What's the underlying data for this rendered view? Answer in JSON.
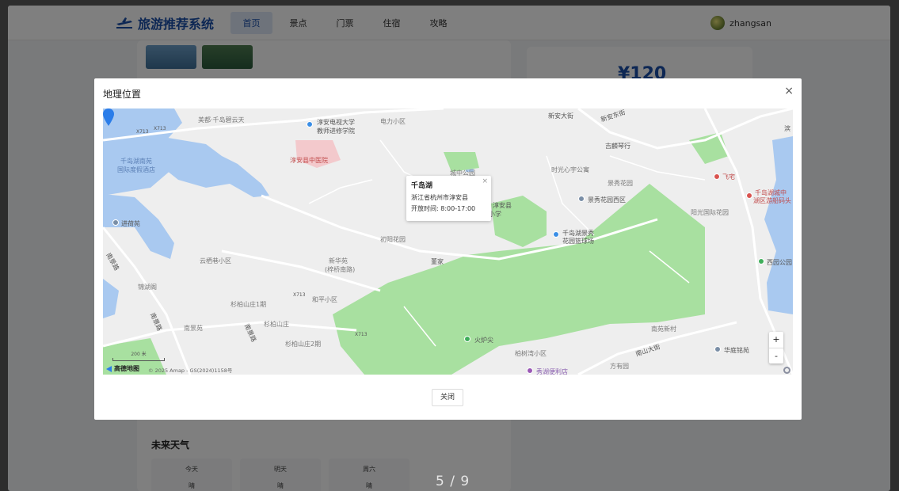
{
  "app": {
    "brand": "旅游推荐系统",
    "nav": [
      {
        "label": "首页",
        "active": true
      },
      {
        "label": "景点",
        "active": false
      },
      {
        "label": "门票",
        "active": false
      },
      {
        "label": "住宿",
        "active": false
      },
      {
        "label": "攻略",
        "active": false
      }
    ],
    "username": "zhangsan"
  },
  "background": {
    "price": "¥120",
    "weather_title": "未来天气",
    "weather": [
      {
        "day": "今天",
        "cond": "晴"
      },
      {
        "day": "明天",
        "cond": "晴"
      },
      {
        "day": "周六",
        "cond": "晴"
      }
    ],
    "page_indicator": "5 / 9"
  },
  "modal": {
    "title": "地理位置",
    "close_icon": "×",
    "close_button": "关闭",
    "map": {
      "info": {
        "name": "千岛湖",
        "address": "浙江省杭州市淳安县",
        "hours": "开放时间: 8:00-17:00",
        "close_icon": "×"
      },
      "labels": [
        "美都·千岛碧云天",
        "淳安电视大学",
        "教师进修学院",
        "电力小区",
        "新安大街",
        "新安东街",
        "吉麟琴行",
        "千岛湖南苑",
        "国际度假酒店",
        "淳安县中医院",
        "城中公园",
        "时光心宇公寓",
        "景秀花园",
        "飞宅",
        "千岛湖城中",
        "湖区游船码头",
        "淳安县",
        "小学",
        "景秀花园西区",
        "进荷苑",
        "初阳花园",
        "千岛湖景秀",
        "花园篮球场",
        "阳光国际花园",
        "西园公园",
        "云栖巷小区",
        "新华苑",
        "(梓桥南路)",
        "董家",
        "锦湖阁",
        "和平小区",
        "杉柏山庄1期",
        "杉柏山庄",
        "南景苑",
        "杉柏山庄2期",
        "南苑新村",
        "火炉尖",
        "南山大街",
        "华庭铭苑",
        "柏树湾小区",
        "方有园",
        "秀湖便利店",
        "南景路",
        "南景路",
        "南景路",
        "X713",
        "X713",
        "X713",
        "X713",
        "滨"
      ],
      "zoom_in": "+",
      "zoom_out": "-",
      "scale": "200 米",
      "logo": "高德地图",
      "copyright": "© 2025 Amap - GS(2024)1158号"
    }
  },
  "colors": {
    "brand": "#1a4ea8",
    "water": "#a9c9f0",
    "park": "#a8e0a0"
  }
}
